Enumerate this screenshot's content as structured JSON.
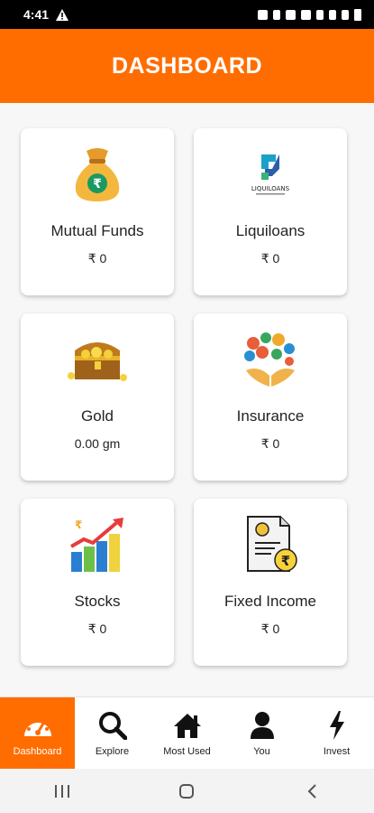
{
  "status_bar": {
    "time": "4:41"
  },
  "header": {
    "title": "DASHBOARD"
  },
  "cards": [
    {
      "title": "Mutual Funds",
      "value": "₹ 0",
      "icon": "money-bag-icon"
    },
    {
      "title": "Liquiloans",
      "value": "₹ 0",
      "icon": "liquiloans-logo"
    },
    {
      "title": "Gold",
      "value": "0.00 gm",
      "icon": "treasure-chest-icon"
    },
    {
      "title": "Insurance",
      "value": "₹ 0",
      "icon": "insurance-hands-icon"
    },
    {
      "title": "Stocks",
      "value": "₹ 0",
      "icon": "growth-chart-icon"
    },
    {
      "title": "Fixed Income",
      "value": "₹ 0",
      "icon": "certificate-rupee-icon"
    }
  ],
  "logo": {
    "text": "LIQUILOANS"
  },
  "bottom_nav": [
    {
      "label": "Dashboard",
      "icon": "speedometer-icon",
      "active": true
    },
    {
      "label": "Explore",
      "icon": "search-icon",
      "active": false
    },
    {
      "label": "Most Used",
      "icon": "home-icon",
      "active": false
    },
    {
      "label": "You",
      "icon": "person-icon",
      "active": false
    },
    {
      "label": "Invest",
      "icon": "bolt-icon",
      "active": false
    }
  ],
  "colors": {
    "primary": "#ff6d00",
    "header_text": "#ffffff",
    "card_text": "#222222"
  }
}
